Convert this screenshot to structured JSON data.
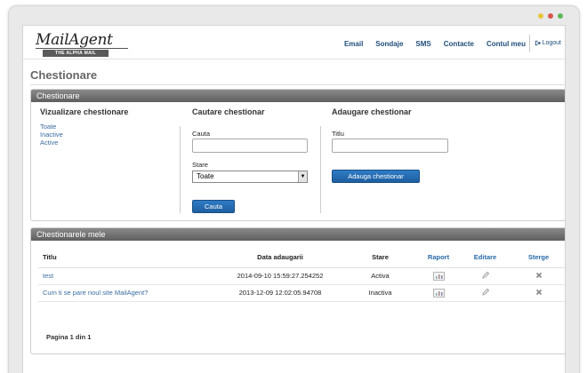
{
  "header": {
    "logo_script": "MailAgent",
    "logo_tag": "THE ALPHA MAIL",
    "nav": [
      "Email",
      "Sondaje",
      "SMS",
      "Contacte",
      "Contul meu"
    ],
    "logout": "Logout"
  },
  "page_title": "Chestionare",
  "panel1": {
    "bar": "Chestionare",
    "view_title": "Vizualizare chestionare",
    "view_links": [
      "Toate",
      "Inactive",
      "Active"
    ],
    "search_title": "Cautare chestionar",
    "search_label": "Cauta",
    "search_value": "",
    "state_label": "Stare",
    "state_selected": "Toate",
    "search_button": "Cauta",
    "add_title": "Adaugare chestionar",
    "add_label": "Titlu",
    "add_value": "",
    "add_button": "Adauga chestionar"
  },
  "panel2": {
    "bar": "Chestionarele mele",
    "columns": [
      "Titlu",
      "Data adaugarii",
      "Stare",
      "Raport",
      "Editare",
      "Sterge"
    ],
    "rows": [
      {
        "title": "test",
        "date": "2014-09-10 15:59:27.254252",
        "state": "Activa"
      },
      {
        "title": "Cum ti se pare noul site MailAgent?",
        "date": "2013-12-09 12:02:05.94708",
        "state": "Inactiva"
      }
    ],
    "pager": "Pagina 1 din 1"
  },
  "colors": {
    "accent": "#1e5f9f",
    "bar": "#6e6e6e",
    "link": "#3b6da0",
    "dot_yellow": "#e8c53a",
    "dot_red": "#d9534f",
    "dot_green": "#5cb85c"
  }
}
